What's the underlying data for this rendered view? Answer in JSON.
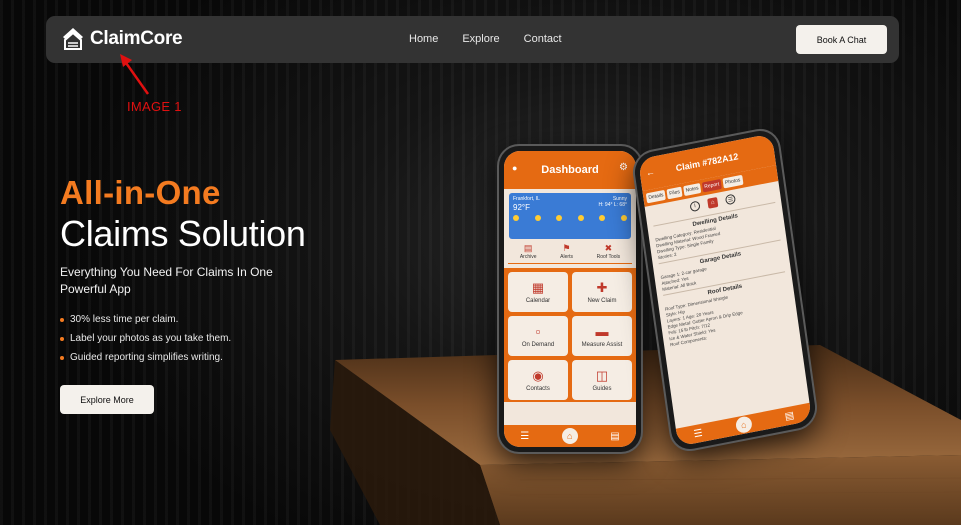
{
  "nav": {
    "brand": "ClaimCore",
    "links": [
      "Home",
      "Explore",
      "Contact"
    ],
    "cta": "Book A Chat"
  },
  "annotation": {
    "label": "IMAGE 1"
  },
  "hero": {
    "headline_accent": "All-in-One",
    "headline_main": "Claims Solution",
    "subcopy": "Everything You Need For Claims In One Powerful App",
    "bullets": [
      "30% less time per claim.",
      "Label your photos as you take them.",
      "Guided reporting simplifies writing."
    ],
    "cta": "Explore More"
  },
  "phone_dashboard": {
    "title": "Dashboard",
    "weather": {
      "location": "Frankfort, IL",
      "temp": "92°F",
      "condition": "Sunny",
      "hilo": "H: 94°  L: 68°"
    },
    "tools": [
      "Archive",
      "Alerts",
      "Roof Tools"
    ],
    "tiles": [
      {
        "label": "Calendar",
        "icon": "calendar-icon"
      },
      {
        "label": "New Claim",
        "icon": "new-claim-icon"
      },
      {
        "label": "On Demand",
        "icon": "clipboard-icon"
      },
      {
        "label": "Measure Assist",
        "icon": "ruler-icon"
      },
      {
        "label": "Contacts",
        "icon": "contacts-icon"
      },
      {
        "label": "Guides",
        "icon": "book-icon"
      }
    ]
  },
  "phone_claim": {
    "title": "Claim #782A12",
    "tabs": [
      "Details",
      "Files",
      "Notes",
      "Report",
      "Photos"
    ],
    "sections": [
      {
        "title": "Dwelling Details",
        "lines": [
          "Dwelling Category: Residential",
          "Dwelling Material: Wood Framed",
          "Dwelling Type: Single Family",
          "Stories: 2"
        ]
      },
      {
        "title": "Garage Details",
        "lines": [
          "Garage 1: 2-car garage",
          "Attached: Yes",
          "Material: All Brick"
        ]
      },
      {
        "title": "Roof Details",
        "lines": [
          "Roof Type: Dimensional Shingle",
          "Style: Hip",
          "Layers: 1    Age: 20 Years",
          "Edge Metal: Gutter Apron & Drip Edge",
          "Felt: 15 lb    Pitch: 7/12",
          "Ice & Water Shield: Yes",
          "Roof Components:"
        ]
      }
    ]
  },
  "colors": {
    "accent": "#f47b20",
    "app_orange": "#e56a12",
    "annotation_red": "#e01010"
  }
}
